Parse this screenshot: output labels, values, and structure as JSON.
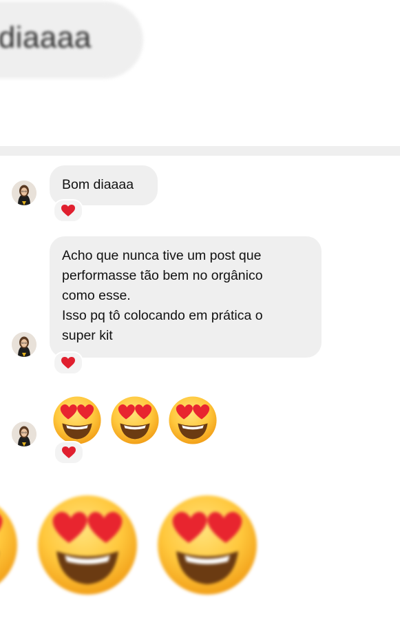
{
  "top_preview": {
    "text": "n diaaaa"
  },
  "messages": [
    {
      "text_lines": [
        "Bom diaaaa"
      ],
      "reaction": "heart"
    },
    {
      "text_lines": [
        "Acho que nunca tive um post que",
        "performasse tão bem no orgânico",
        "como esse.",
        "Isso pq tô colocando em prática o",
        "super kit"
      ],
      "reaction": "heart"
    },
    {
      "emojis": [
        "heart-eyes",
        "heart-eyes",
        "heart-eyes"
      ],
      "reaction": "heart"
    }
  ],
  "colors": {
    "bubble": "#efefef",
    "heart": "#e0202f",
    "emoji_face": "#ffc83d"
  }
}
